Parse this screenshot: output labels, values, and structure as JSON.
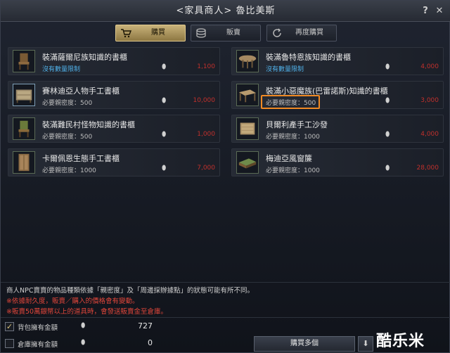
{
  "window": {
    "title": "<家具商人> 魯比美斯",
    "help": "?",
    "close": "✕"
  },
  "tabs": [
    {
      "label": "購買",
      "icon": "cart-icon",
      "active": true
    },
    {
      "label": "販賣",
      "icon": "coins-icon",
      "active": false
    },
    {
      "label": "再度購買",
      "icon": "refresh-icon",
      "active": false
    }
  ],
  "items": [
    {
      "name": "裝滿薩爾尼族知識的書櫃",
      "sub": "沒有數量限制",
      "sub_style": "blue",
      "price": "1,100",
      "icon": "chair-icon"
    },
    {
      "name": "裝滿魯特恩族知識的書櫃",
      "sub": "沒有數量限制",
      "sub_style": "blue",
      "price": "4,000",
      "icon": "round-table-icon"
    },
    {
      "name": "賽林迪亞人物手工書櫃",
      "sub": "必要親密度：500",
      "sub_style": "normal",
      "price": "10,000",
      "icon": "cabinet-icon"
    },
    {
      "name": "裝滿小惡魔族(巴雷諾斯)知識的書櫃",
      "sub": "必要親密度：500",
      "sub_style": "normal",
      "price": "3,000",
      "icon": "desk-icon"
    },
    {
      "name": "裝滿難民村怪物知識的書櫃",
      "sub": "必要親密度：500",
      "sub_style": "normal",
      "price": "1,000",
      "icon": "chair-icon"
    },
    {
      "name": "貝爾利產手工沙發",
      "sub": "必要親密度：1000",
      "sub_style": "normal",
      "price": "4,000",
      "icon": "dresser-icon"
    },
    {
      "name": "卡爾佩恩生態手工書櫃",
      "sub": "必要親密度：1000",
      "sub_style": "normal",
      "price": "7,000",
      "icon": "wardrobe-icon"
    },
    {
      "name": "梅迪亞風窗簾",
      "sub": "必要親密度：1000",
      "sub_style": "normal",
      "price": "28,000",
      "icon": "bed-icon"
    }
  ],
  "notice": {
    "line1": "商人NPC賣賣的物品種類依據「親密度」及「周邊採辦據點」的狀態可能有所不同。",
    "line2": "※依據耐久度，販賣／購入的價格會有變動。",
    "line3": "※販賣50萬銀幣以上的道具時，會發送販賣金至倉庫。"
  },
  "bottom": {
    "bag_label": "背包擁有金額",
    "bag_value": "727",
    "bag_checked": "✓",
    "warehouse_label": "倉庫擁有金額",
    "warehouse_value": "0",
    "buy_multi": "購買多個",
    "down": "⬇"
  },
  "watermark": "酷乐米",
  "colors": {
    "accent": "#c8b27a",
    "price": "#c0302c",
    "unlimited": "#4fb0e8",
    "highlight": "#f08a24"
  }
}
